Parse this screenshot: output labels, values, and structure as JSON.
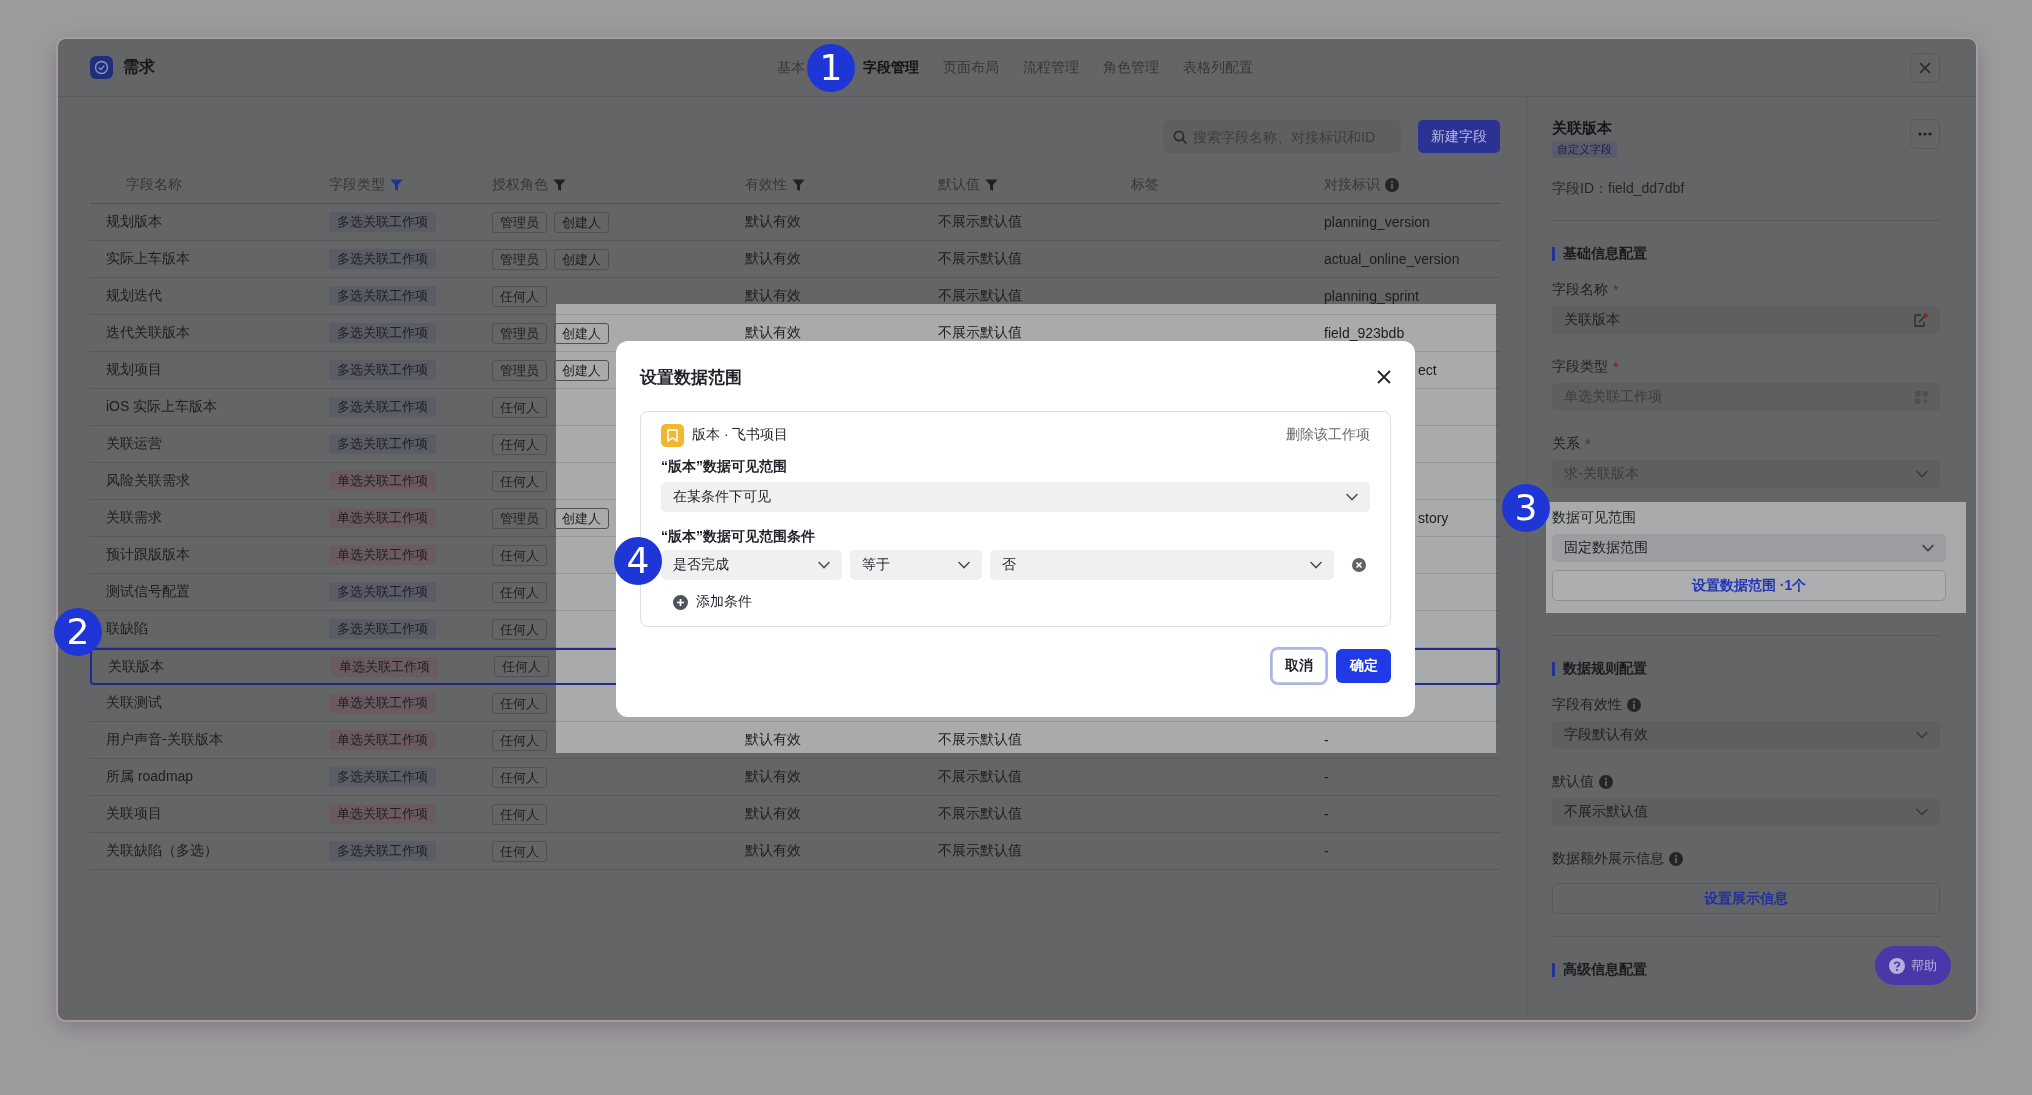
{
  "app": {
    "title": "需求"
  },
  "tabs": [
    {
      "label": "基本",
      "selected": false
    },
    {
      "label": "字段管理",
      "selected": true
    },
    {
      "label": "页面布局",
      "selected": false
    },
    {
      "label": "流程管理",
      "selected": false
    },
    {
      "label": "角色管理",
      "selected": false
    },
    {
      "label": "表格列配置",
      "selected": false
    }
  ],
  "callouts": [
    {
      "number": "1"
    },
    {
      "number": "2"
    },
    {
      "number": "3"
    },
    {
      "number": "4"
    }
  ],
  "toolbar": {
    "search": {
      "placeholder": "搜索字段名称、对接标识和ID"
    },
    "new_button": "新建字段"
  },
  "table": {
    "columns": [
      {
        "label": "字段名称"
      },
      {
        "label": "字段类型",
        "kind": "filter",
        "active": true
      },
      {
        "label": "授权角色",
        "kind": "filter",
        "active": false
      },
      {
        "label": "有效性",
        "kind": "filter",
        "active": false
      },
      {
        "label": "默认值",
        "kind": "filter",
        "active": false
      },
      {
        "label": "标签"
      },
      {
        "label": "对接标识",
        "kind": "info"
      }
    ],
    "rows": [
      {
        "name": "规划版本",
        "type": {
          "text": "多选关联工作项",
          "color": "#5a5c66"
        },
        "roles": [
          "管理员",
          "创建人"
        ],
        "validity": "默认有效",
        "default": "不展示默认值",
        "ident": {
          "text": "planning_version"
        },
        "selected": false
      },
      {
        "name": "实际上车版本",
        "type": {
          "text": "多选关联工作项",
          "color": "#5a5c66"
        },
        "roles": [
          "管理员",
          "创建人"
        ],
        "validity": "默认有效",
        "default": "不展示默认值",
        "ident": {
          "text": "actual_online_version",
          "cut": false
        },
        "selected": false
      },
      {
        "name": "规划迭代",
        "type": {
          "text": "多选关联工作项",
          "color": "#5a5c66"
        },
        "roles": [
          "任何人"
        ],
        "validity": "默认有效",
        "default": "不展示默认值",
        "ident": {
          "text": "planning_sprint",
          "cut": false
        },
        "selected": false
      },
      {
        "name": "迭代关联版本",
        "type": {
          "text": "多选关联工作项",
          "color": "#5a5c66"
        },
        "roles": [
          "管理员",
          "创建人"
        ],
        "validity": "默认有效",
        "default": "不展示默认值",
        "ident": {
          "text": "field_923bdb",
          "cut": false
        },
        "selected": false
      },
      {
        "name": "规划项目",
        "type": {
          "text": "多选关联工作项",
          "color": "#5a5c66"
        },
        "roles": [
          "管理员",
          "创建人"
        ],
        "ident": {
          "text": "ect",
          "cut": true
        },
        "selected": false
      },
      {
        "name": "iOS 实际上车版本",
        "type": {
          "text": "多选关联工作项",
          "color": "#5a5c66"
        },
        "roles": [
          "任何人"
        ],
        "selected": false
      },
      {
        "name": "关联运营",
        "type": {
          "text": "多选关联工作项",
          "color": "#5a5c66"
        },
        "roles": [
          "任何人"
        ],
        "selected": false
      },
      {
        "name": "风险关联需求",
        "type": {
          "text": "单选关联工作项",
          "color": "#6b5b61"
        },
        "roles": [
          "任何人"
        ],
        "selected": false
      },
      {
        "name": "关联需求",
        "type": {
          "text": "单选关联工作项",
          "color": "#6b5b61"
        },
        "roles": [
          "管理员",
          "创建人"
        ],
        "ident": {
          "text": "story",
          "cut": true
        },
        "selected": false
      },
      {
        "name": "预计跟版版本",
        "type": {
          "text": "单选关联工作项",
          "color": "#6b5b61"
        },
        "roles": [
          "任何人"
        ],
        "selected": false
      },
      {
        "name": "测试信号配置",
        "type": {
          "text": "多选关联工作项",
          "color": "#5a5c66"
        },
        "roles": [
          "任何人"
        ],
        "selected": false
      },
      {
        "name": "联缺陷",
        "type": {
          "text": "多选关联工作项",
          "color": "#5a5c66"
        },
        "roles": [
          "任何人"
        ],
        "selected": false
      },
      {
        "name": "关联版本",
        "type": {
          "text": "单选关联工作项",
          "color": "#6b5b61"
        },
        "roles": [
          "任何人"
        ],
        "selected": true
      },
      {
        "name": "关联测试",
        "type": {
          "text": "单选关联工作项",
          "color": "#6b5b61"
        },
        "roles": [
          "任何人"
        ],
        "selected": false
      },
      {
        "name": "用户声音-关联版本",
        "type": {
          "text": "单选关联工作项",
          "color": "#6b5b61"
        },
        "roles": [
          "任何人"
        ],
        "validity": "默认有效",
        "default": "不展示默认值",
        "ident": {
          "text": "-"
        },
        "selected": false
      },
      {
        "name": "所属 roadmap",
        "type": {
          "text": "多选关联工作项",
          "color": "#5a5c66"
        },
        "roles": [
          "任何人"
        ],
        "validity": "默认有效",
        "default": "不展示默认值",
        "ident": {
          "text": "-"
        },
        "selected": false
      },
      {
        "name": "关联项目",
        "type": {
          "text": "单选关联工作项",
          "color": "#6b5b61"
        },
        "roles": [
          "任何人"
        ],
        "validity": "默认有效",
        "default": "不展示默认值",
        "ident": {
          "text": "-"
        },
        "selected": false
      },
      {
        "name": "关联缺陷（多选）",
        "type": {
          "text": "多选关联工作项",
          "color": "#5a5c66"
        },
        "roles": [
          "任何人"
        ],
        "validity": "默认有效",
        "default": "不展示默认值",
        "ident": {
          "text": "-"
        },
        "selected": false
      }
    ]
  },
  "detail_panel": {
    "title": "关联版本",
    "badge": "自定义字段",
    "field_id": "字段ID：field_dd7dbf",
    "sections": [
      {
        "heading": "基础信息配置",
        "items": [
          {
            "kind": "input",
            "label": "字段名称",
            "required": true,
            "required_mark": "*",
            "value": "关联版本",
            "disabled": false
          },
          {
            "kind": "input",
            "label": "字段类型",
            "required": true,
            "required_mark": "*",
            "value": "单选关联工作项",
            "disabled": true
          },
          {
            "kind": "select",
            "label": "关系",
            "required": true,
            "required_mark": "*",
            "value": "求-关联版本",
            "disabled": true
          },
          {
            "kind": "select",
            "label": "数据可见范围",
            "value": "固定数据范围",
            "disabled": false,
            "highlighted": true,
            "action": "设置数据范围 ·1个"
          }
        ]
      },
      {
        "heading": "数据规则配置",
        "items": [
          {
            "kind": "select",
            "label": "字段有效性",
            "info": true,
            "value": "字段默认有效",
            "disabled": false
          },
          {
            "kind": "select",
            "label": "默认值",
            "info": true,
            "value": "不展示默认值",
            "disabled": false
          },
          {
            "kind": "button",
            "label": "数据额外展示信息",
            "info": true,
            "action": "设置展示信息"
          }
        ]
      },
      {
        "heading": "高级信息配置"
      }
    ]
  },
  "dialog": {
    "title": "设置数据范围",
    "work_item": {
      "name": "版本 · 飞书项目",
      "remove": "删除该工作项",
      "scope_label": "“版本”数据可见范围",
      "scope_value": "在某条件下可见",
      "conditions_label": "“版本”数据可见范围条件",
      "conditions": [
        {
          "field": "是否完成",
          "operator": "等于",
          "value": "否"
        }
      ],
      "add": "添加条件"
    },
    "cancel": "取消",
    "confirm": "确定"
  },
  "help_button": "帮助"
}
